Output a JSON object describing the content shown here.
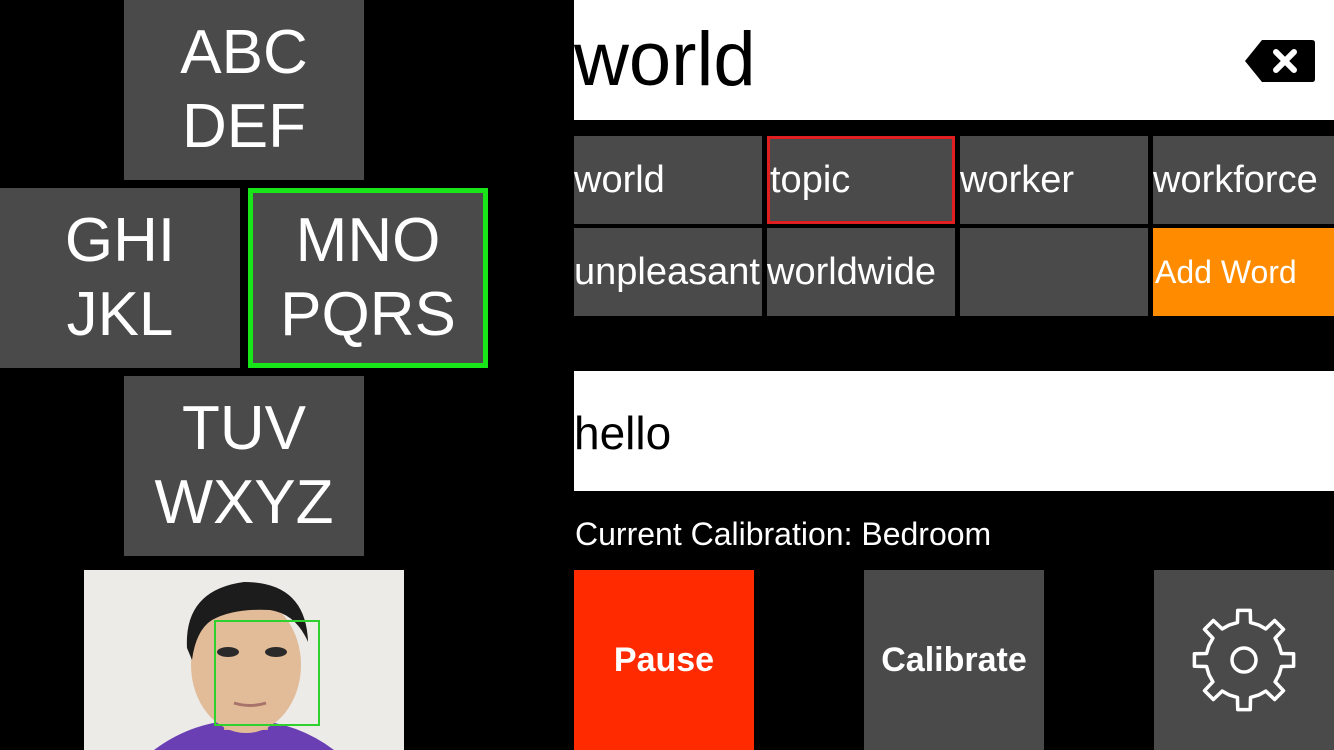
{
  "keyboard": {
    "keys": [
      {
        "line1": "ABC",
        "line2": "DEF"
      },
      {
        "line1": "GHI",
        "line2": "JKL"
      },
      {
        "line1": "MNO",
        "line2": "PQRS"
      },
      {
        "line1": "TUV",
        "line2": "WXYZ"
      }
    ],
    "active_key_index": 2,
    "active_color": "#19e619"
  },
  "current_word": "world",
  "suggestions": [
    {
      "label": "world"
    },
    {
      "label": "topic",
      "selected": true
    },
    {
      "label": "worker"
    },
    {
      "label": "workforce"
    },
    {
      "label": "unpleasant"
    },
    {
      "label": "worldwide"
    },
    {
      "label": ""
    },
    {
      "label": "Add Word"
    }
  ],
  "sentence": "hello",
  "calibration_label": "Current Calibration: Bedroom",
  "buttons": {
    "pause": "Pause",
    "calibrate": "Calibrate",
    "settings_icon": "gear-icon"
  },
  "colors": {
    "pause": "#ff2a00",
    "add_word": "#ff8c00",
    "selected_border": "#e02020",
    "tile": "#4a4a4a"
  },
  "camera": {
    "face_detected": true
  }
}
